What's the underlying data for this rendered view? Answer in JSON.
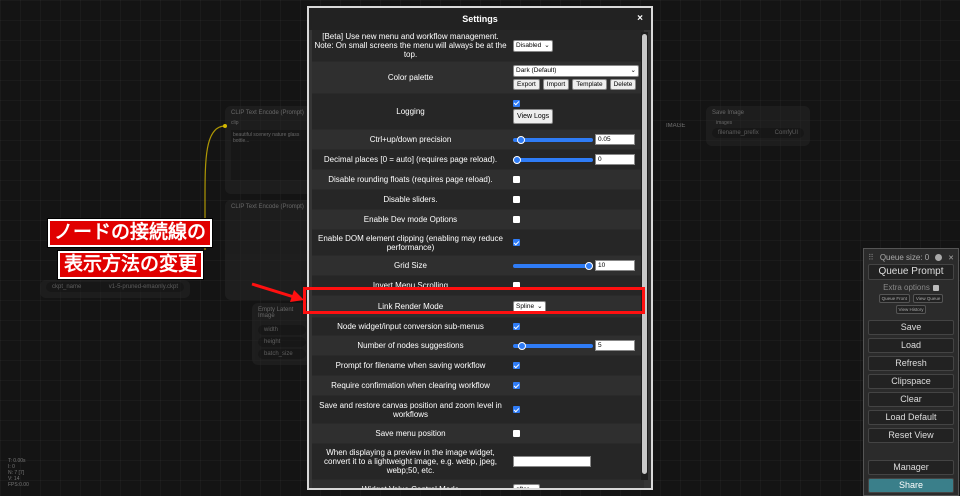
{
  "modal": {
    "title": "Settings",
    "close": "×",
    "rows": [
      {
        "label": "[Beta] Use new menu and workflow management. Note: On small screens the menu will always be at the top.",
        "type": "select",
        "value": "Disabled"
      },
      {
        "label": "Color palette",
        "type": "palette",
        "value": "Dark (Default)",
        "buttons": [
          "Export",
          "Import",
          "Template",
          "Delete"
        ]
      },
      {
        "label": "Logging",
        "type": "logging",
        "button": "View Logs"
      },
      {
        "label": "Ctrl+up/down precision",
        "type": "slider",
        "value": "0.05",
        "fill": 0.05
      },
      {
        "label": "Decimal places [0 = auto] (requires page reload).",
        "type": "slider",
        "value": "0",
        "fill": 0
      },
      {
        "label": "Disable rounding floats (requires page reload).",
        "type": "checkbox",
        "checked": false
      },
      {
        "label": "Disable sliders.",
        "type": "checkbox",
        "checked": false
      },
      {
        "label": "Enable Dev mode Options",
        "type": "checkbox",
        "checked": false
      },
      {
        "label": "Enable DOM element clipping (enabling may reduce performance)",
        "type": "checkbox",
        "checked": true
      },
      {
        "label": "Grid Size",
        "type": "slider",
        "value": "10",
        "fill": 1
      },
      {
        "label": "Invert Menu Scrolling",
        "type": "checkbox",
        "checked": false
      },
      {
        "label": "Link Render Mode",
        "type": "select",
        "value": "Spline"
      },
      {
        "label": "Node widget/input conversion sub-menus",
        "type": "checkbox",
        "checked": true
      },
      {
        "label": "Number of nodes suggestions",
        "type": "slider",
        "value": "5",
        "fill": 0.07
      },
      {
        "label": "Prompt for filename when saving workflow",
        "type": "checkbox",
        "checked": true
      },
      {
        "label": "Require confirmation when clearing workflow",
        "type": "checkbox",
        "checked": true
      },
      {
        "label": "Save and restore canvas position and zoom level in workflows",
        "type": "checkbox",
        "checked": true
      },
      {
        "label": "Save menu position",
        "type": "checkbox",
        "checked": false
      },
      {
        "label": "When displaying a preview in the image widget, convert it to a lightweight image, e.g. webp, jpeg, webp;50, etc.",
        "type": "text",
        "value": ""
      },
      {
        "label": "Widget Value Control Mode",
        "type": "select",
        "value": "after"
      }
    ]
  },
  "annotation": {
    "line1": "ノードの接続線の",
    "line2": "表示方法の変更"
  },
  "panel": {
    "queue_size": "Queue size: 0",
    "queue_prompt": "Queue Prompt",
    "extra_options": "Extra options",
    "queue_front": "Queue Front",
    "view_queue": "View Queue",
    "view_history": "View History",
    "buttons": [
      "Save",
      "Load",
      "Refresh",
      "Clipspace",
      "Clear",
      "Load Default",
      "Reset View"
    ],
    "manager": "Manager",
    "share": "Share"
  },
  "nodes": {
    "clip1_title": "CLIP Text Encode (Prompt)",
    "clip1_input": "clip",
    "clip1_text": "beautiful scenery nature glass bottle...",
    "clip2_title": "CLIP Text Encode (Prompt)",
    "ckpt_name": "ckpt_name",
    "ckpt_value": "v1-5-pruned-emaonly.ckpt",
    "latent_title": "Empty Latent Image",
    "latent_width": "width",
    "latent_height": "height",
    "latent_batch": "batch_size",
    "save_title": "Save Image",
    "save_input": "images",
    "save_prefix": "filename_prefix",
    "save_prefix_value": "ComfyUI",
    "image_label": "IMAGE"
  },
  "stats": [
    "T: 0.00s",
    "I: 0",
    "N: 7 [7]",
    "V: 14",
    "FPS:0.00"
  ]
}
